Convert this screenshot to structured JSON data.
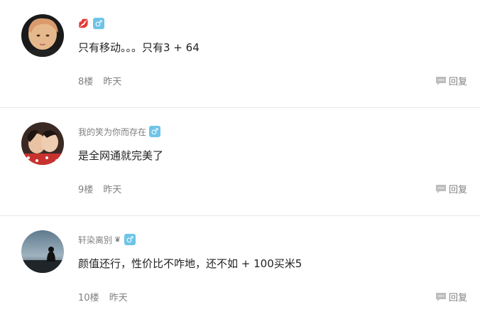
{
  "comments": [
    {
      "username": "",
      "badges": [
        "lips-icon",
        "male-icon"
      ],
      "male_symbol": "♂",
      "lips_symbol": "💋",
      "content": "只有移动。。。只有3 + 64",
      "floor": "8楼",
      "time": "昨天",
      "reply_label": "回复"
    },
    {
      "username": "我的笑为你而存在",
      "badges": [
        "male-icon"
      ],
      "male_symbol": "♂",
      "content": "是全网通就完美了",
      "floor": "9楼",
      "time": "昨天",
      "reply_label": "回复"
    },
    {
      "username": "轩染离别",
      "badges": [
        "crown-icon",
        "male-icon"
      ],
      "male_symbol": "♂",
      "crown_symbol": "♛",
      "content": "颜值还行，性价比不咋地，还不如 + 100买米5",
      "floor": "10楼",
      "time": "昨天",
      "reply_label": "回复"
    }
  ],
  "colors": {
    "male_badge": "#6fc4e6",
    "meta_text": "#808080"
  }
}
